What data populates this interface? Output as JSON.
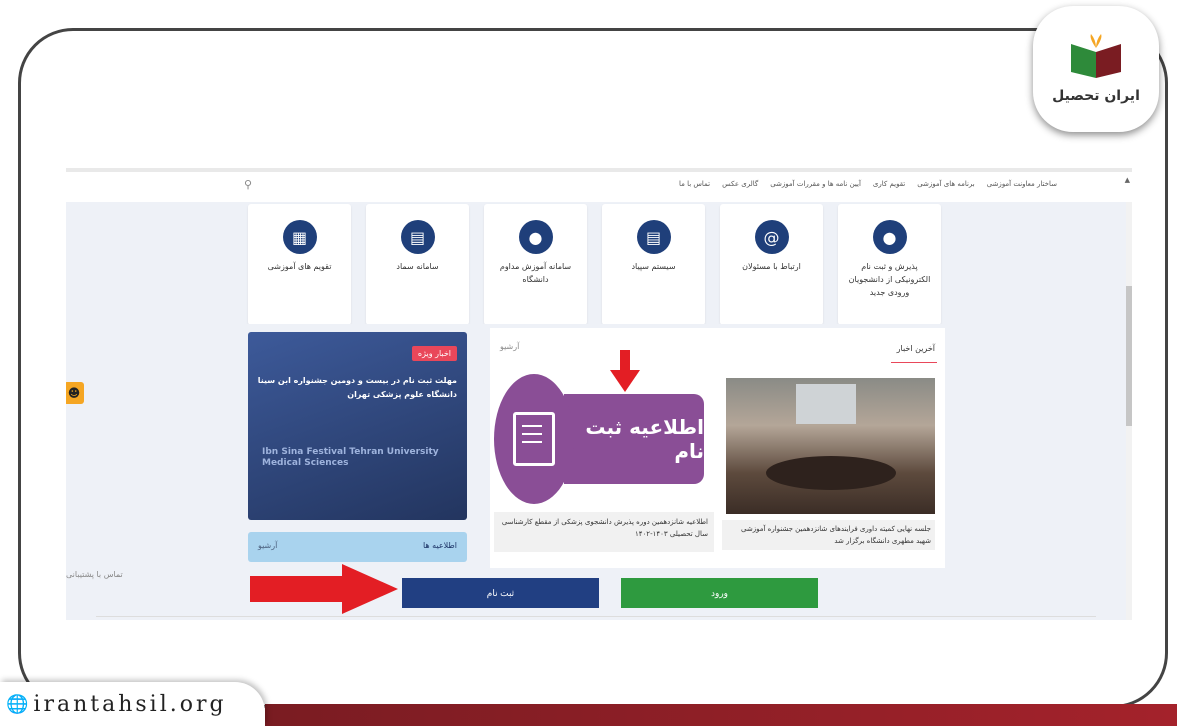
{
  "brand": {
    "logo_text": "ایران تحصیل",
    "site_url": "irantahsil.org"
  },
  "navbar": {
    "items": [
      "ساختار معاونت آموزشی",
      "برنامه های آموزشی",
      "تقویم کاری",
      "آیین نامه ها و مقررات آموزشی",
      "گالری عکس",
      "تماس با ما"
    ]
  },
  "cards": [
    {
      "label": "پذیرش و ثبت نام الکترونیکی از دانشجویان ورودی جدید",
      "icon": "user-icon"
    },
    {
      "label": "ارتباط با مسئولان",
      "icon": "at-icon"
    },
    {
      "label": "سیستم سپیاد",
      "icon": "book-icon"
    },
    {
      "label": "سامانه آموزش مداوم دانشگاه",
      "icon": "user-icon"
    },
    {
      "label": "سامانه سماد",
      "icon": "book-icon"
    },
    {
      "label": "تقویم های آموزشی",
      "icon": "calendar-icon"
    }
  ],
  "special": {
    "tag": "اخبار ویژه",
    "headline": "مهلت ثبت نام در بیست و دومین جشنواره ابن سینا دانشگاه علوم پزشکی تهران",
    "en_text": "Ibn Sina Festival Tehran University Medical Sciences"
  },
  "announcements": {
    "title": "اطلاعیه ها",
    "archive": "آرشیو"
  },
  "news": {
    "title": "آخرین اخبار",
    "archive": "آرشیو",
    "item1_caption": "جلسه نهایی کمیته داوری فرایندهای شانزدهمین جشنواره آموزشی شهید مطهری دانشگاه برگزار شد",
    "item2_caption": "اطلاعیه شانزدهمین دوره پذیرش دانشجوی پزشکی از مقطع کارشناسی سال تحصیلی ۱۴۰۳-۱۴۰۲",
    "banner_text": "اطلاعیه ثبت نام"
  },
  "contact": "تماس با پشتیبانی",
  "buttons": {
    "register": "ثبت نام",
    "login": "ورود"
  },
  "colors": {
    "accent_blue": "#213f82",
    "accent_green": "#2e9a3f",
    "arrow_red": "#e31e24",
    "brand_red": "#7a1c22"
  }
}
